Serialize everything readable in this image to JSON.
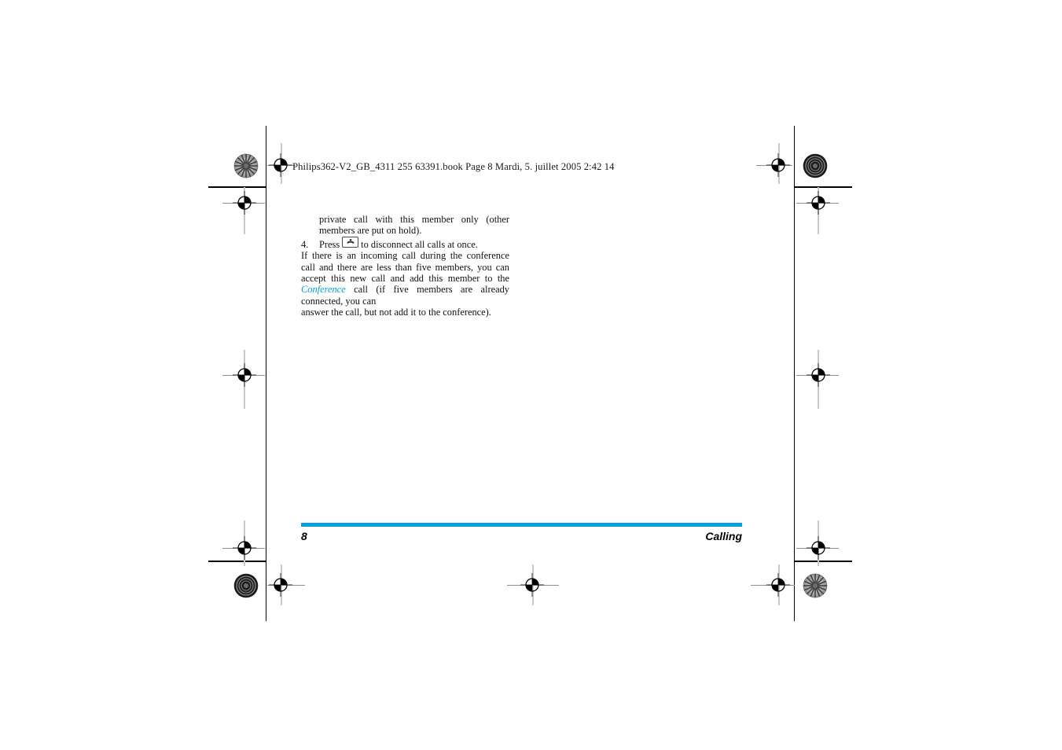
{
  "document": {
    "header_line": "Philips362-V2_GB_4311 255 63391.book  Page 8  Mardi, 5. juillet 2005  2:42 14",
    "body": {
      "continued_paragraph": "private call with this member only (other members are put on hold).",
      "step": {
        "number": "4.",
        "text_before_icon": "Press",
        "icon": "hangup-key-icon",
        "text_after_icon": "to disconnect all calls at once."
      },
      "paragraph_lines": [
        "If there is an incoming call during the conference call",
        "and there are less than five members, you can accept",
        "this new call and add this member to the",
        "call (if five members are already connected, you can",
        "answer the call, but not add it to the conference)."
      ],
      "paragraph_accent_term": "Conference"
    },
    "footer": {
      "page_number": "8",
      "section_title": "Calling"
    },
    "colors": {
      "accent": "#00a0e3",
      "text": "#15110f",
      "trim": "#000000",
      "guide": "#c9c9c9"
    },
    "prepress_marks": {
      "top_left_target": "halftone-star-target-icon",
      "top_left_registration": "registration-crosshair-icon",
      "top_right_registration": "registration-crosshair-icon",
      "top_right_target": "concentric-circle-target-icon",
      "left_mid_registration": "registration-crosshair-icon",
      "right_mid_registration": "registration-crosshair-icon",
      "left_upper_registration": "registration-crosshair-icon",
      "right_upper_registration": "registration-crosshair-icon",
      "left_lower_registration": "registration-crosshair-icon",
      "right_lower_registration": "registration-crosshair-icon",
      "bottom_left_target": "concentric-circle-target-icon",
      "bottom_left_registration": "registration-crosshair-icon",
      "bottom_center_registration": "registration-crosshair-icon",
      "bottom_right_registration": "registration-crosshair-icon",
      "bottom_right_target": "halftone-star-target-icon"
    }
  }
}
